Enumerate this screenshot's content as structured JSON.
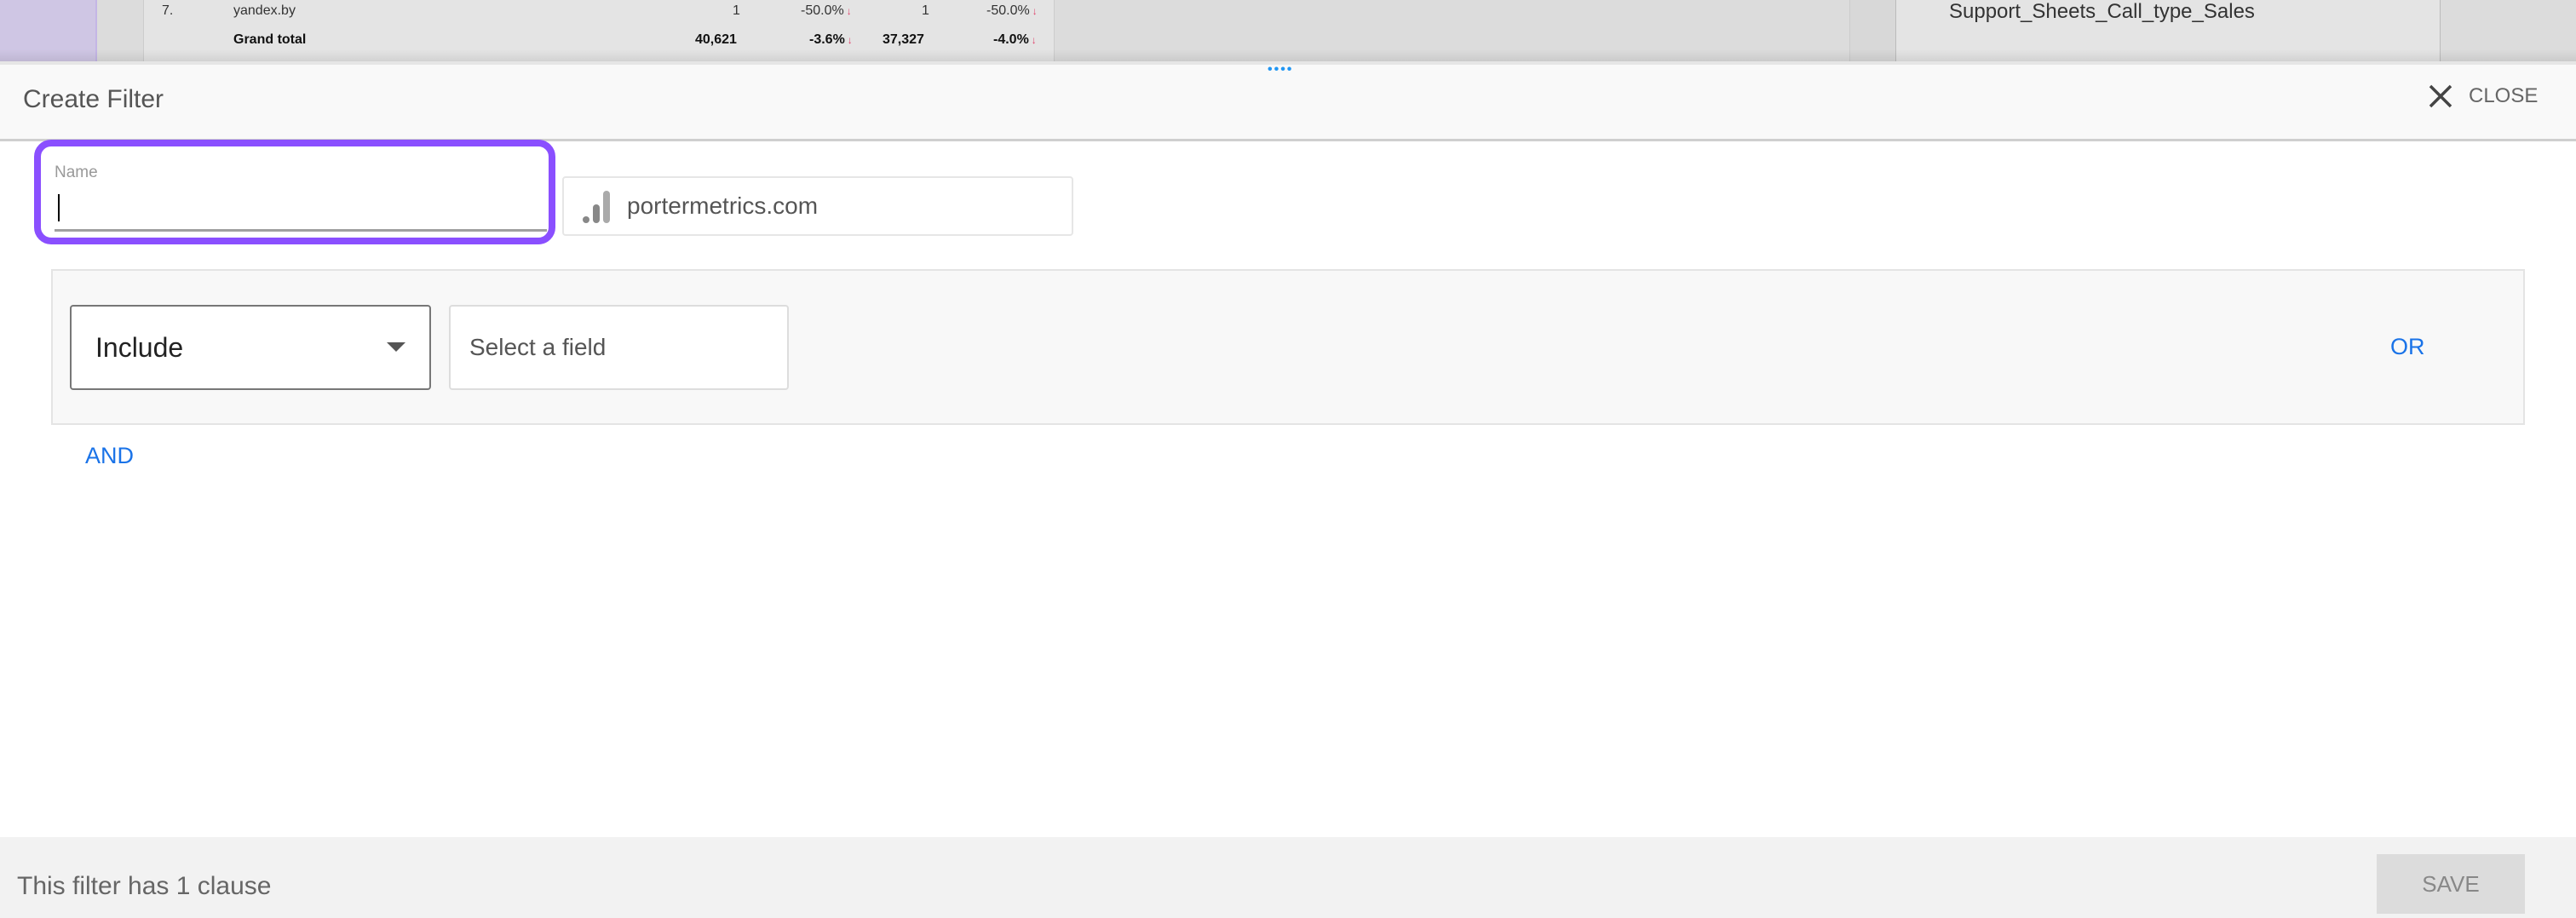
{
  "background_report": {
    "rows": [
      {
        "index": "7.",
        "name": "yandex.by",
        "v1": "1",
        "c1": "-50.0%",
        "v2": "1",
        "c2": "-50.0%"
      },
      {
        "index": "",
        "name": "Grand total",
        "v1": "40,621",
        "c1": "-3.6%",
        "v2": "37,327",
        "c2": "-4.0%"
      }
    ],
    "down_arrow": "↓",
    "right_panel_text": "Support_Sheets_Call_type_Sales"
  },
  "dialog": {
    "title": "Create Filter",
    "close_label": "CLOSE",
    "name_label": "Name",
    "name_value": "",
    "data_source": "portermetrics.com",
    "include_select": "Include",
    "field_placeholder": "Select a field",
    "or_label": "OR",
    "and_label": "AND",
    "footer_status": "This filter has 1 clause",
    "save_label": "SAVE",
    "accent_color": "#1a73e8",
    "focus_ring_color": "#8a4fff"
  }
}
